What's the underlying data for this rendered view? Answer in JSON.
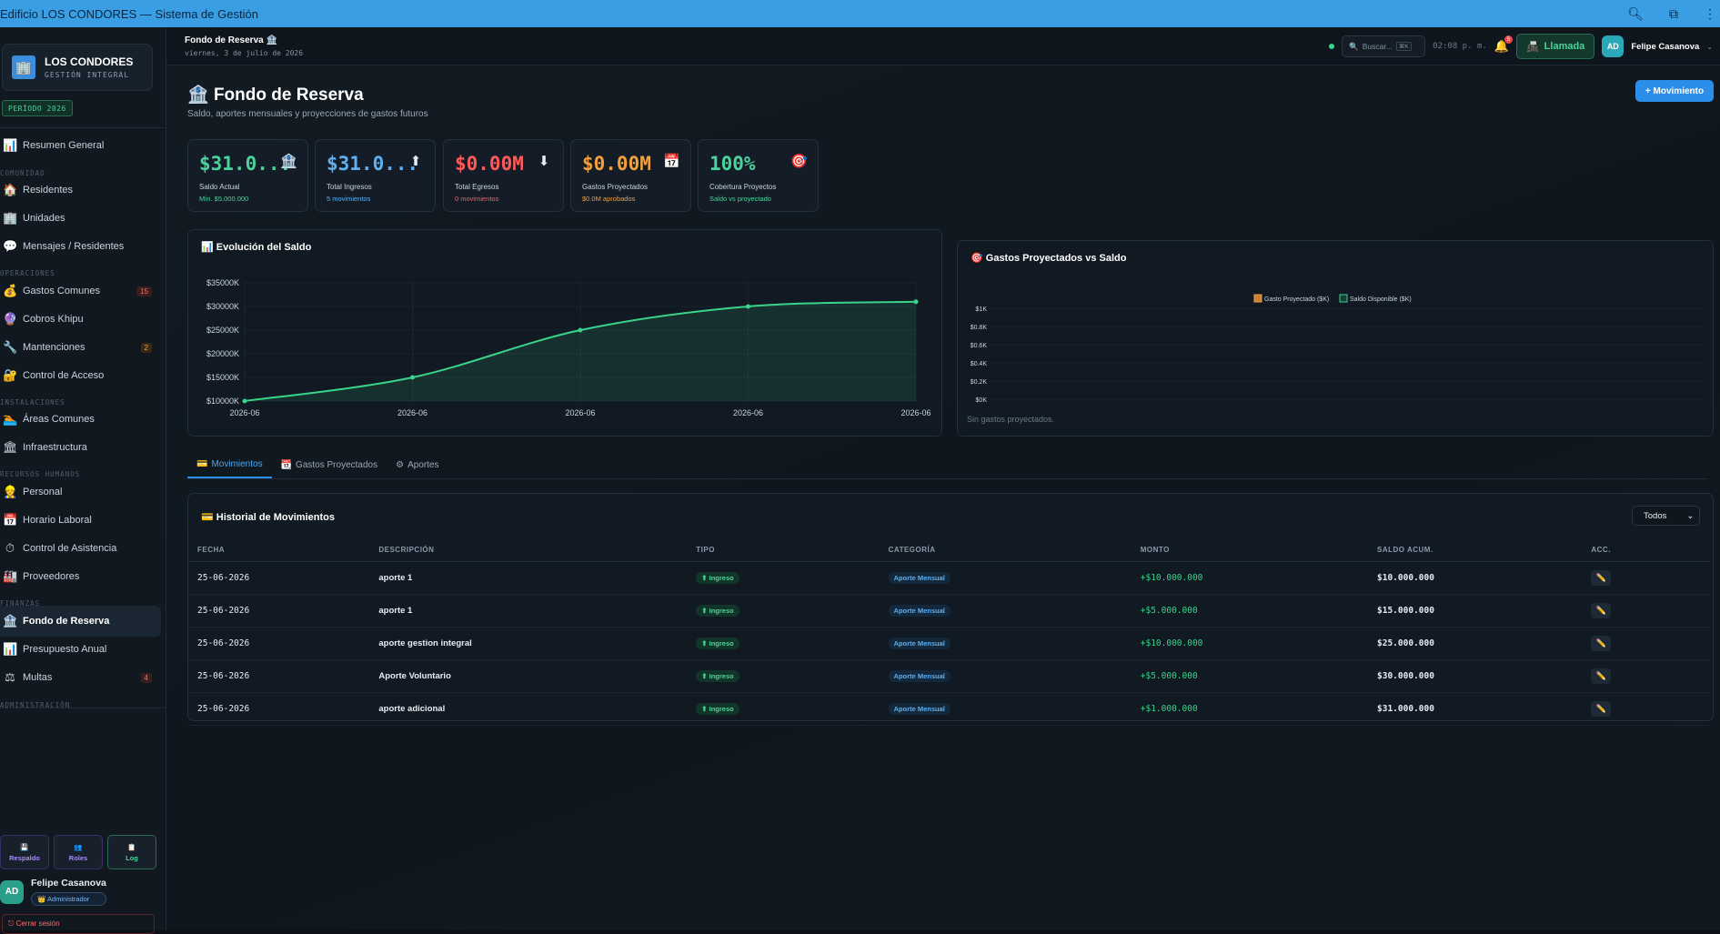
{
  "window": {
    "title": "Edificio LOS CONDORES — Sistema de Gestión"
  },
  "brand": {
    "name": "LOS CONDORES",
    "subtitle": "GESTIÓN INTEGRAL",
    "period": "PERÍODO 2026"
  },
  "sidebar": {
    "items": [
      {
        "label": "Resumen General",
        "icon": "chart-icon"
      },
      {
        "label": "Residentes",
        "icon": "house-icon"
      },
      {
        "label": "Unidades",
        "icon": "building-icon"
      },
      {
        "label": "Mensajes / Residentes",
        "icon": "chat-icon"
      },
      {
        "label": "Gastos Comunes",
        "icon": "money-bag-icon",
        "badge": "15"
      },
      {
        "label": "Cobros Khipu",
        "icon": "gem-icon"
      },
      {
        "label": "Mantenciones",
        "icon": "wrench-icon",
        "badge": "2"
      },
      {
        "label": "Control de Acceso",
        "icon": "lock-icon"
      },
      {
        "label": "Áreas Comunes",
        "icon": "pool-icon"
      },
      {
        "label": "Infraestructura",
        "icon": "columns-icon"
      },
      {
        "label": "Personal",
        "icon": "worker-icon"
      },
      {
        "label": "Horario Laboral",
        "icon": "calendar-icon"
      },
      {
        "label": "Control de Asistencia",
        "icon": "stopwatch-icon"
      },
      {
        "label": "Proveedores",
        "icon": "factory-icon"
      },
      {
        "label": "Fondo de Reserva",
        "icon": "bank-icon"
      },
      {
        "label": "Presupuesto Anual",
        "icon": "chart-icon"
      },
      {
        "label": "Multas",
        "icon": "scale-icon",
        "badge": "4"
      }
    ],
    "sections": [
      "COMUNIDAD",
      "OPERACIONES",
      "INSTALACIONES",
      "RECURSOS HUMANOS",
      "FINANZAS",
      "ADMINISTRACIÓN"
    ],
    "bottom_buttons": [
      "Respaldo",
      "Roles",
      "Log"
    ],
    "user": {
      "initials": "AD",
      "name": "Felipe Casanova",
      "role": "Administrador"
    },
    "logout": "Cerrar sesión"
  },
  "topbar": {
    "title": "Fondo de Reserva",
    "date": "viernes, 3 de julio de 2026",
    "search_placeholder": "Buscar...",
    "search_kbd": "⌘K",
    "clock": "02:08 p. m.",
    "notif_count": "5",
    "call_label": "Llamada",
    "user_initials": "AD",
    "user_name": "Felipe Casanova"
  },
  "page": {
    "title": "Fondo de Reserva",
    "subtitle": "Saldo, aportes mensuales y proyecciones de gastos futuros",
    "add_button": "+ Movimiento"
  },
  "cards": [
    {
      "value": "$31.0...",
      "label": "Saldo Actual",
      "sub": "Mín. $5.000.000",
      "color": "#4ad39a",
      "icon": "bank-icon"
    },
    {
      "value": "$31.0...",
      "label": "Total Ingresos",
      "sub": "5 movimientos",
      "color": "#5fb0f0",
      "icon": "arrow-up-icon"
    },
    {
      "value": "$0.00M",
      "label": "Total Egresos",
      "sub": "0 movimientos",
      "color": "#ff5a5a",
      "icon": "arrow-down-icon"
    },
    {
      "value": "$0.00M",
      "label": "Gastos Proyectados",
      "sub": "$0.0M aprobados",
      "color": "#f0a03c",
      "icon": "calendar-icon"
    },
    {
      "value": "100%",
      "label": "Cobertura Proyectos",
      "sub": "Saldo vs proyectado",
      "color": "#4ad39a",
      "icon": "target-icon"
    }
  ],
  "chart_data": [
    {
      "type": "area",
      "title": "Evolución del Saldo",
      "x": [
        "2026-06",
        "2026-06",
        "2026-06",
        "2026-06",
        "2026-06"
      ],
      "y_ticks": [
        "$10000K",
        "$15000K",
        "$20000K",
        "$25000K",
        "$30000K",
        "$35000K"
      ],
      "series": [
        {
          "values": [
            10000,
            15000,
            25000,
            30000,
            31000
          ]
        }
      ],
      "ylim": [
        10000,
        35000
      ],
      "grid": true,
      "color": "#3ad38a"
    },
    {
      "type": "bar",
      "title": "Gastos Proyectados vs Saldo",
      "legend": [
        "Gasto Proyectado ($K)",
        "Saldo Disponible ($K)"
      ],
      "legend_colors": [
        "#f0a03c",
        "#3ad38a"
      ],
      "y_ticks": [
        "$0K",
        "$0.2K",
        "$0.4K",
        "$0.6K",
        "$0.8K",
        "$1K"
      ],
      "ylim": [
        0,
        1
      ],
      "categories": [],
      "empty_message": "Sin gastos proyectados."
    }
  ],
  "tabs": [
    {
      "label": "Movimientos",
      "icon": "card-icon"
    },
    {
      "label": "Gastos Proyectados",
      "icon": "calendar-icon"
    },
    {
      "label": "Aportes",
      "icon": "gear-icon"
    }
  ],
  "history": {
    "title": "Historial de Movimientos",
    "filter": "Todos",
    "columns": [
      "FECHA",
      "DESCRIPCIÓN",
      "TIPO",
      "CATEGORÍA",
      "MONTO",
      "SALDO ACUM.",
      "ACC."
    ],
    "rows": [
      {
        "fecha": "25-06-2026",
        "desc": "aporte 1",
        "tipo": "⬆ Ingreso",
        "cat": "Aporte Mensual",
        "monto": "+$10.000.000",
        "saldo": "$10.000.000"
      },
      {
        "fecha": "25-06-2026",
        "desc": "aporte 1",
        "tipo": "⬆ Ingreso",
        "cat": "Aporte Mensual",
        "monto": "+$5.000.000",
        "saldo": "$15.000.000"
      },
      {
        "fecha": "25-06-2026",
        "desc": "aporte gestion integral",
        "tipo": "⬆ Ingreso",
        "cat": "Aporte Mensual",
        "monto": "+$10.000.000",
        "saldo": "$25.000.000"
      },
      {
        "fecha": "25-06-2026",
        "desc": "Aporte Voluntario",
        "tipo": "⬆ Ingreso",
        "cat": "Aporte Mensual",
        "monto": "+$5.000.000",
        "saldo": "$30.000.000"
      },
      {
        "fecha": "25-06-2026",
        "desc": "aporte adicional",
        "tipo": "⬆ Ingreso",
        "cat": "Aporte Mensual",
        "monto": "+$1.000.000",
        "saldo": "$31.000.000"
      }
    ]
  }
}
